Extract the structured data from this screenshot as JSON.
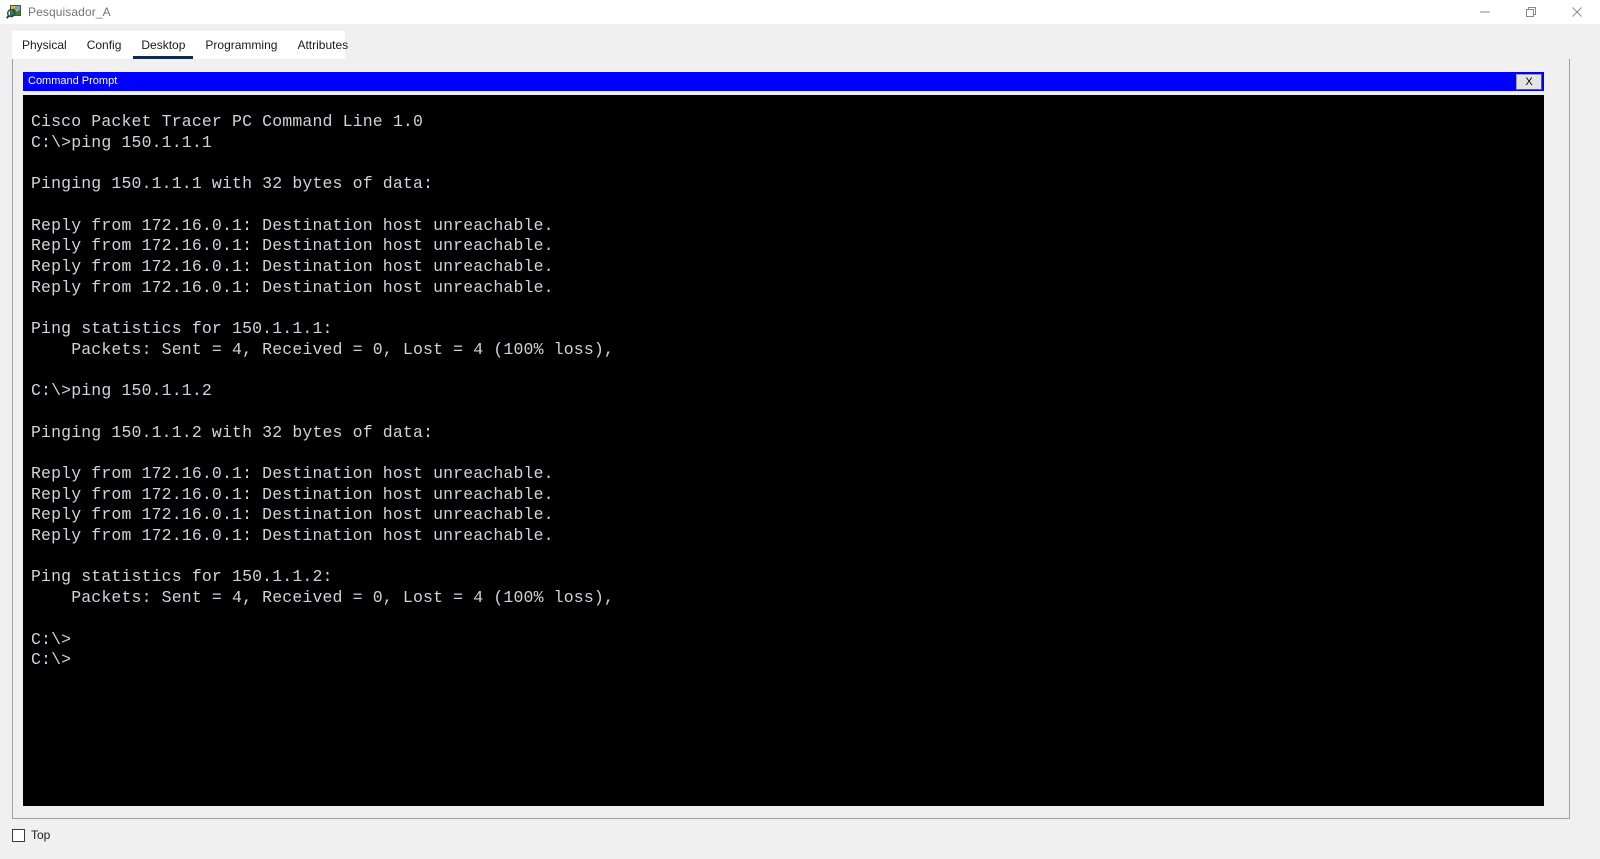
{
  "window": {
    "title": "Pesquisador_A",
    "icon": "packet-tracer-pc-icon",
    "controls": {
      "minimize": "minimize-icon",
      "maximize": "restore-icon",
      "close": "close-icon"
    },
    "progress_strip": {
      "fill_color": "#0a7bd4",
      "track_color": "#2b2b2b"
    }
  },
  "tabs": [
    {
      "label": "Physical",
      "active": false
    },
    {
      "label": "Config",
      "active": false
    },
    {
      "label": "Desktop",
      "active": true
    },
    {
      "label": "Programming",
      "active": false
    },
    {
      "label": "Attributes",
      "active": false
    }
  ],
  "command_prompt": {
    "title": "Command Prompt",
    "close_label": "X",
    "titlebar_color": "#0000ff",
    "background_color": "#000000",
    "text_color": "#d2d2da",
    "content": "Cisco Packet Tracer PC Command Line 1.0\nC:\\>ping 150.1.1.1\n\nPinging 150.1.1.1 with 32 bytes of data:\n\nReply from 172.16.0.1: Destination host unreachable.\nReply from 172.16.0.1: Destination host unreachable.\nReply from 172.16.0.1: Destination host unreachable.\nReply from 172.16.0.1: Destination host unreachable.\n\nPing statistics for 150.1.1.1:\n    Packets: Sent = 4, Received = 0, Lost = 4 (100% loss),\n\nC:\\>ping 150.1.1.2\n\nPinging 150.1.1.2 with 32 bytes of data:\n\nReply from 172.16.0.1: Destination host unreachable.\nReply from 172.16.0.1: Destination host unreachable.\nReply from 172.16.0.1: Destination host unreachable.\nReply from 172.16.0.1: Destination host unreachable.\n\nPing statistics for 150.1.1.2:\n    Packets: Sent = 4, Received = 0, Lost = 4 (100% loss),\n\nC:\\>\nC:\\>"
  },
  "footer": {
    "top_checkbox_label": "Top",
    "top_checkbox_checked": false
  }
}
